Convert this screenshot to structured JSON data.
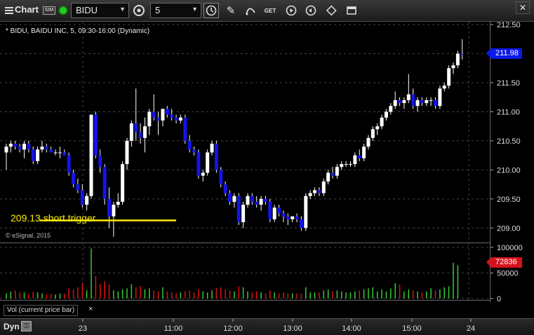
{
  "toolbar": {
    "title": "Chart",
    "sim_label": "SIM",
    "symbol": "BIDU",
    "interval": "5",
    "icons": [
      "menu-icon",
      "link-icon",
      "interval-settings-icon",
      "clock-icon",
      "pencil-icon",
      "curve-icon",
      "get-icon",
      "play-icon",
      "replay-icon",
      "style-icon",
      "window-icon",
      "close-icon"
    ]
  },
  "chart": {
    "header": "* BIDU, BAIDU INC, 5, 09:30-16:00 (Dynamic)",
    "watermark": "© eSignal, 2015",
    "annotation": "209.13 short trigger",
    "annotation_level": 209.13,
    "last_price": "211.98",
    "volume_label": "Vol (current price bar)",
    "volume_close": "×",
    "last_volume": "72836",
    "bottom_left": "Dyn",
    "colors": {
      "up": "#ffffff",
      "down": "#1414e6",
      "volume_up": "#33cc33",
      "volume_down": "#dd1111",
      "trigger_line": "#ffee00"
    }
  },
  "chart_data": {
    "type": "candlestick",
    "price_axis": {
      "ticks": [
        "212.50",
        "212.00",
        "211.50",
        "211.00",
        "210.50",
        "210.00",
        "209.50",
        "209.00"
      ],
      "ylim": [
        208.75,
        212.55
      ]
    },
    "volume_axis": {
      "ticks": [
        "100000",
        "50000",
        "0"
      ],
      "ylim": [
        0,
        100000
      ]
    },
    "time_axis": {
      "ticks": [
        "23",
        "11:00",
        "12:00",
        "13:00",
        "14:00",
        "15:00",
        "24"
      ]
    },
    "candles": [
      [
        210.3,
        210.45,
        210.0,
        210.4
      ],
      [
        210.4,
        210.5,
        210.3,
        210.45
      ],
      [
        210.45,
        210.5,
        210.35,
        210.4
      ],
      [
        210.4,
        210.45,
        210.3,
        210.35
      ],
      [
        210.35,
        210.5,
        210.2,
        210.45
      ],
      [
        210.45,
        210.5,
        210.3,
        210.35
      ],
      [
        210.35,
        210.4,
        210.1,
        210.15
      ],
      [
        210.15,
        210.4,
        210.1,
        210.35
      ],
      [
        210.35,
        210.5,
        210.3,
        210.4
      ],
      [
        210.4,
        210.45,
        210.3,
        210.35
      ],
      [
        210.35,
        210.4,
        210.3,
        210.3
      ],
      [
        210.3,
        210.35,
        210.25,
        210.3
      ],
      [
        210.3,
        210.4,
        210.2,
        210.3
      ],
      [
        210.3,
        210.35,
        210.25,
        210.25
      ],
      [
        210.25,
        210.3,
        209.9,
        209.95
      ],
      [
        209.95,
        210.0,
        209.7,
        209.75
      ],
      [
        209.75,
        209.85,
        209.6,
        209.65
      ],
      [
        209.65,
        209.75,
        209.35,
        209.4
      ],
      [
        209.4,
        209.6,
        209.3,
        209.55
      ],
      [
        209.55,
        210.95,
        209.5,
        210.95
      ],
      [
        210.95,
        211.0,
        210.2,
        210.25
      ],
      [
        210.25,
        210.35,
        209.95,
        210.05
      ],
      [
        210.05,
        210.1,
        209.4,
        209.5
      ],
      [
        209.5,
        209.7,
        209.0,
        209.2
      ],
      [
        209.2,
        209.45,
        208.85,
        209.4
      ],
      [
        209.4,
        209.6,
        209.35,
        209.45
      ],
      [
        209.45,
        210.15,
        209.4,
        210.1
      ],
      [
        210.1,
        210.55,
        210.0,
        210.5
      ],
      [
        210.5,
        210.85,
        210.4,
        210.8
      ],
      [
        210.8,
        211.4,
        210.5,
        210.65
      ],
      [
        210.65,
        210.8,
        210.45,
        210.55
      ],
      [
        210.55,
        210.9,
        210.3,
        210.75
      ],
      [
        210.75,
        211.05,
        210.6,
        211.0
      ],
      [
        211.0,
        211.3,
        210.85,
        210.9
      ],
      [
        210.9,
        211.0,
        210.6,
        210.85
      ],
      [
        210.85,
        211.05,
        210.75,
        211.05
      ],
      [
        211.05,
        211.1,
        210.9,
        210.95
      ],
      [
        210.95,
        211.05,
        210.85,
        210.9
      ],
      [
        210.9,
        210.95,
        210.8,
        210.85
      ],
      [
        210.85,
        210.95,
        210.8,
        210.9
      ],
      [
        210.9,
        210.95,
        210.45,
        210.5
      ],
      [
        210.5,
        210.6,
        210.3,
        210.35
      ],
      [
        210.35,
        210.4,
        210.25,
        210.3
      ],
      [
        210.3,
        210.35,
        209.85,
        209.9
      ],
      [
        209.9,
        210.0,
        209.8,
        209.95
      ],
      [
        209.95,
        210.35,
        209.9,
        210.3
      ],
      [
        210.3,
        210.5,
        210.25,
        210.45
      ],
      [
        210.45,
        210.5,
        209.95,
        210.0
      ],
      [
        210.0,
        210.05,
        209.7,
        209.75
      ],
      [
        209.75,
        209.8,
        209.55,
        209.6
      ],
      [
        209.6,
        209.65,
        209.4,
        209.45
      ],
      [
        209.45,
        209.6,
        209.35,
        209.55
      ],
      [
        209.55,
        209.6,
        209.05,
        209.1
      ],
      [
        209.1,
        209.45,
        209.0,
        209.4
      ],
      [
        209.4,
        209.6,
        209.35,
        209.55
      ],
      [
        209.55,
        209.6,
        209.4,
        209.45
      ],
      [
        209.45,
        209.55,
        209.35,
        209.4
      ],
      [
        209.4,
        209.55,
        209.3,
        209.5
      ],
      [
        209.5,
        209.55,
        209.4,
        209.45
      ],
      [
        209.45,
        209.5,
        209.1,
        209.15
      ],
      [
        209.15,
        209.4,
        209.1,
        209.35
      ],
      [
        209.35,
        209.4,
        209.2,
        209.25
      ],
      [
        209.25,
        209.3,
        209.1,
        209.2
      ],
      [
        209.2,
        209.25,
        209.05,
        209.15
      ],
      [
        209.15,
        209.2,
        209.1,
        209.2
      ],
      [
        209.2,
        209.25,
        209.1,
        209.15
      ],
      [
        209.15,
        209.2,
        208.95,
        209.0
      ],
      [
        209.0,
        209.6,
        208.95,
        209.55
      ],
      [
        209.55,
        209.65,
        209.5,
        209.6
      ],
      [
        209.6,
        209.7,
        209.55,
        209.65
      ],
      [
        209.65,
        209.7,
        209.55,
        209.6
      ],
      [
        209.6,
        209.85,
        209.55,
        209.8
      ],
      [
        209.8,
        210.0,
        209.75,
        209.95
      ],
      [
        209.95,
        210.05,
        209.85,
        209.9
      ],
      [
        209.9,
        210.1,
        209.85,
        210.05
      ],
      [
        210.05,
        210.15,
        210.0,
        210.1
      ],
      [
        210.1,
        210.15,
        210.05,
        210.1
      ],
      [
        210.1,
        210.15,
        210.05,
        210.1
      ],
      [
        210.1,
        210.3,
        210.05,
        210.25
      ],
      [
        210.25,
        210.35,
        210.15,
        210.2
      ],
      [
        210.2,
        210.45,
        210.15,
        210.4
      ],
      [
        210.4,
        210.6,
        210.35,
        210.55
      ],
      [
        210.55,
        210.75,
        210.5,
        210.7
      ],
      [
        210.7,
        210.8,
        210.6,
        210.75
      ],
      [
        210.75,
        210.95,
        210.7,
        210.9
      ],
      [
        210.9,
        211.05,
        210.85,
        211.0
      ],
      [
        211.0,
        211.15,
        210.95,
        211.1
      ],
      [
        211.1,
        211.35,
        211.05,
        211.2
      ],
      [
        211.2,
        211.25,
        211.1,
        211.15
      ],
      [
        211.15,
        211.25,
        211.05,
        211.2
      ],
      [
        211.2,
        211.65,
        211.15,
        211.3
      ],
      [
        211.3,
        211.4,
        211.05,
        211.1
      ],
      [
        211.1,
        211.25,
        211.0,
        211.2
      ],
      [
        211.2,
        211.25,
        211.1,
        211.15
      ],
      [
        211.15,
        211.25,
        211.1,
        211.2
      ],
      [
        211.2,
        211.25,
        211.1,
        211.2
      ],
      [
        211.2,
        211.25,
        211.05,
        211.1
      ],
      [
        211.1,
        211.45,
        211.05,
        211.4
      ],
      [
        211.4,
        211.5,
        211.35,
        211.45
      ],
      [
        211.45,
        211.8,
        211.4,
        211.75
      ],
      [
        211.75,
        211.85,
        211.65,
        211.8
      ],
      [
        211.8,
        212.05,
        211.75,
        212.0
      ],
      [
        212.0,
        212.25,
        211.9,
        211.98
      ]
    ],
    "volumes": [
      10,
      14,
      16,
      12,
      12,
      8,
      13,
      12,
      10,
      8,
      9,
      8,
      10,
      9,
      20,
      18,
      22,
      30,
      16,
      98,
      44,
      28,
      34,
      28,
      16,
      14,
      18,
      20,
      28,
      22,
      24,
      18,
      20,
      16,
      14,
      22,
      14,
      12,
      10,
      12,
      14,
      16,
      12,
      18,
      14,
      12,
      16,
      20,
      22,
      18,
      16,
      14,
      24,
      22,
      14,
      12,
      14,
      12,
      10,
      16,
      12,
      10,
      12,
      10,
      10,
      10,
      10,
      22,
      12,
      12,
      12,
      16,
      18,
      14,
      16,
      14,
      12,
      12,
      14,
      16,
      18,
      20,
      22,
      14,
      18,
      14,
      20,
      30,
      28,
      14,
      18,
      16,
      14,
      12,
      14,
      20,
      16,
      18,
      22,
      24,
      70,
      65
    ]
  }
}
